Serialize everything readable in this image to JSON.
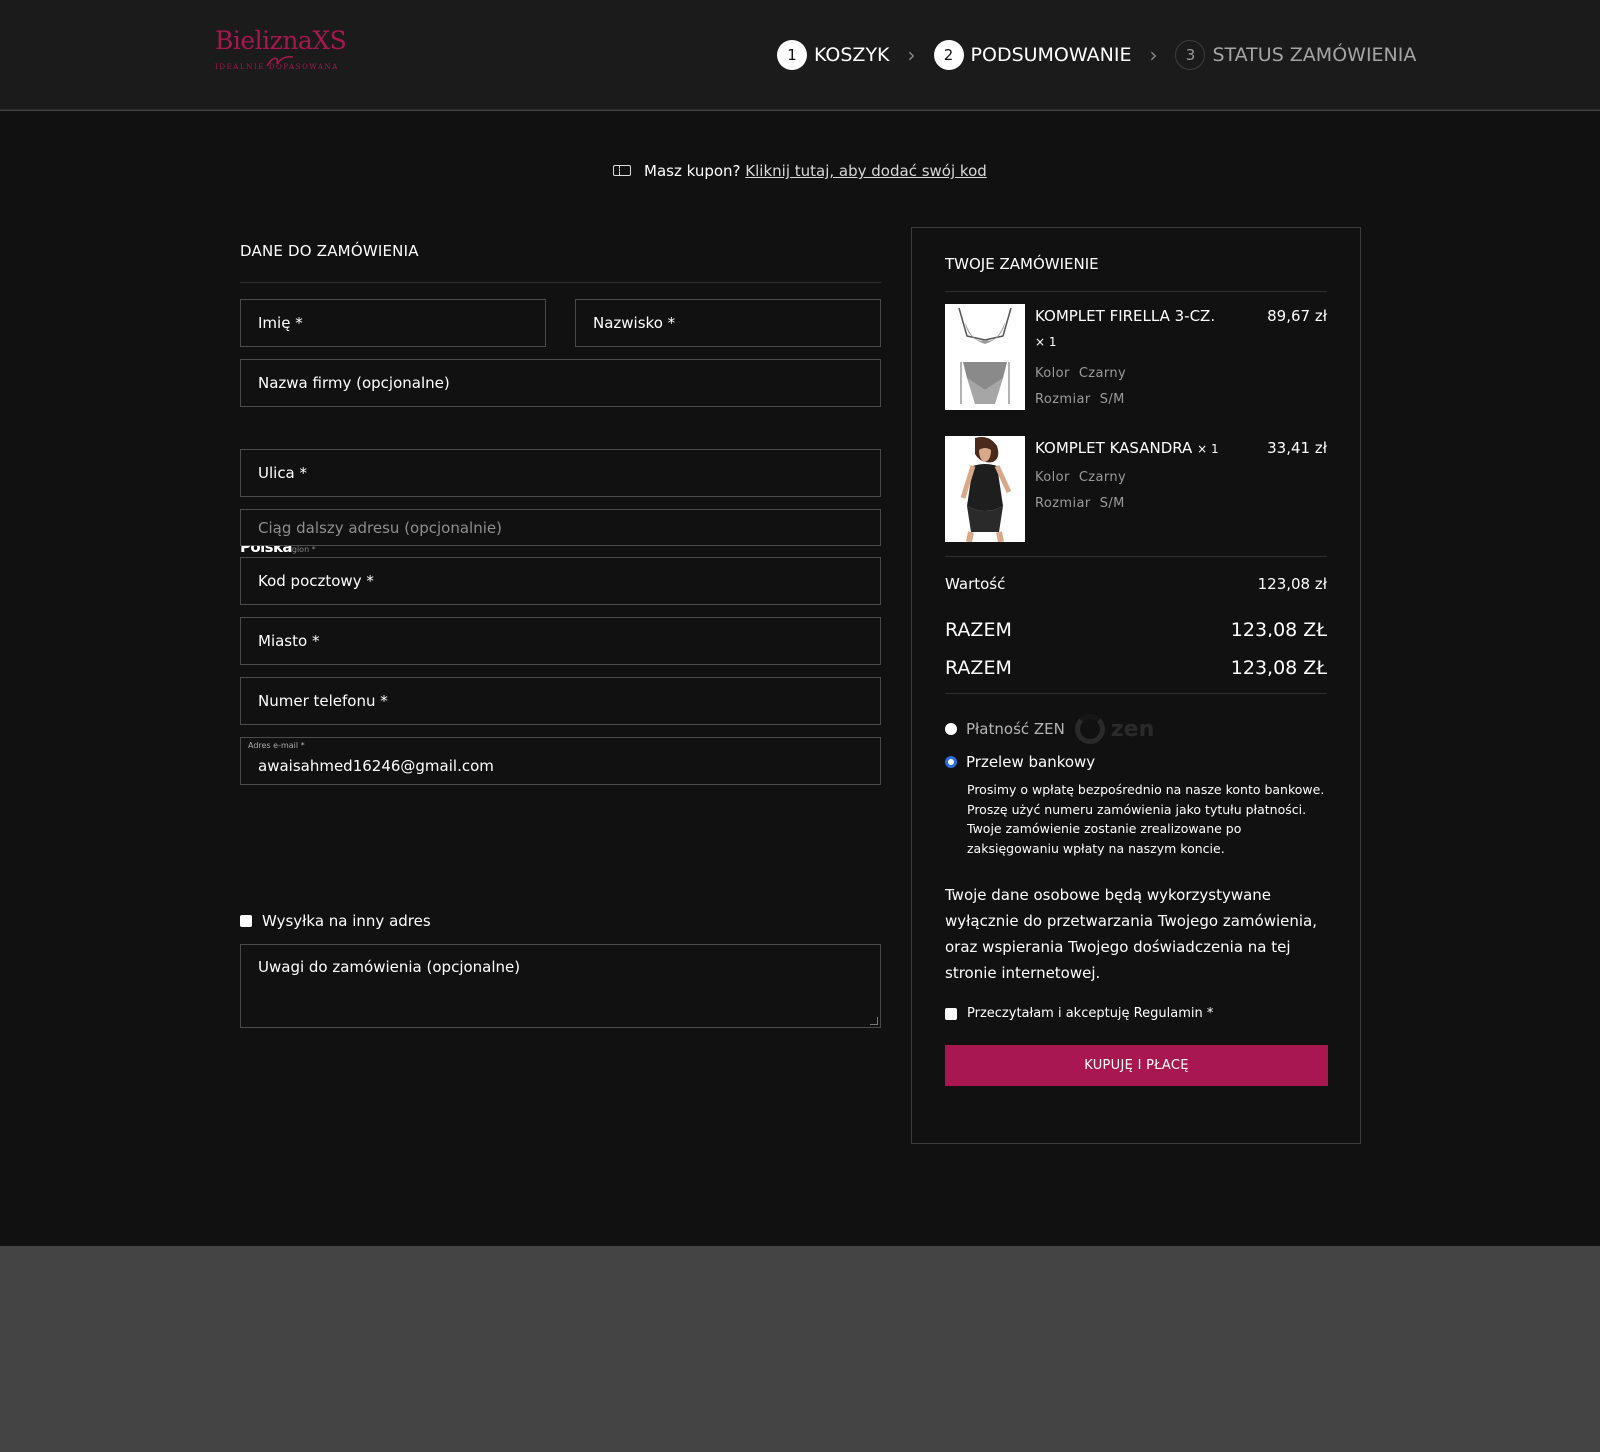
{
  "header": {
    "logo_text": "BieliznaXS",
    "logo_tagline": "IDEALNIE DOPASOWANA",
    "steps": [
      {
        "number": "1",
        "label": "KOSZYK"
      },
      {
        "number": "2",
        "label": "PODSUMOWANIE"
      },
      {
        "number": "3",
        "label": "STATUS ZAMÓWIENIA"
      }
    ]
  },
  "coupon": {
    "question": "Masz kupon?",
    "link": "Kliknij tutaj, aby dodać swój kod"
  },
  "billing": {
    "title": "DANE DO ZAMÓWIENIA",
    "first_name_label": "Imię *",
    "last_name_label": "Nazwisko *",
    "company_label": "Nazwa firmy (opcjonalne)",
    "country_value": "Polska",
    "country_label": "gion *",
    "street_label": "Ulica *",
    "address2_placeholder": "Ciąg dalszy adresu (opcjonalnie)",
    "postcode_label": "Kod pocztowy *",
    "city_label": "Miasto *",
    "phone_label": "Numer telefonu *",
    "email_label": "Adres e-mail *",
    "email_value": "awaisahmed16246@gmail.com",
    "ship_different_label": "Wysyłka na inny adres",
    "notes_label": "Uwagi do zamówienia (opcjonalne)"
  },
  "order": {
    "title": "TWOJE ZAMÓWIENIE",
    "items": [
      {
        "name": "KOMPLET FIRELLA 3-CZ.",
        "qty": "× 1",
        "price": "89,67 zł",
        "color_label": "Kolor",
        "color": "Czarny",
        "size_label": "Rozmiar",
        "size": "S/M"
      },
      {
        "name": "KOMPLET KASANDRA",
        "qty": "× 1",
        "price": "33,41 zł",
        "color_label": "Kolor",
        "color": "Czarny",
        "size_label": "Rozmiar",
        "size": "S/M"
      }
    ],
    "subtotal_label": "Wartość",
    "subtotal_value": "123,08 zł",
    "total_label": "RAZEM",
    "total_value": "123,08 ZŁ",
    "payments": [
      {
        "label": "Płatność ZEN",
        "logo": "zen",
        "selected": false
      },
      {
        "label": "Przelew bankowy",
        "selected": true
      }
    ],
    "bank_transfer_desc": "Prosimy o wpłatę bezpośrednio na nasze konto bankowe. Proszę użyć numeru zamówienia jako tytułu płatności. Twoje zamówienie zostanie zrealizowane po zaksięgowaniu wpłaty na naszym koncie.",
    "privacy_text": "Twoje dane osobowe będą wykorzystywane wyłącznie do przetwarzania Twojego zamówienia, oraz wspierania Twojego doświadczenia na tej stronie internetowej.",
    "terms_label": "Przeczytałam i akceptuję Regulamin *",
    "buy_button": "KUPUJĘ I PŁACĘ"
  },
  "colors": {
    "accent": "#a8174f",
    "header_bg": "#1b1b1b",
    "content_bg": "#111111",
    "footer_bg": "#444444"
  }
}
